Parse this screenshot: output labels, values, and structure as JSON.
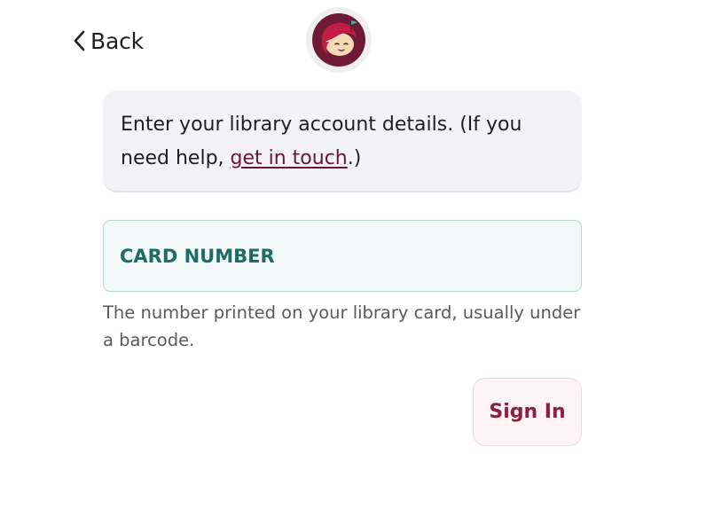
{
  "nav": {
    "back_label": "Back"
  },
  "info": {
    "text_before": "Enter your library account details. (If you need help, ",
    "link": "get in touch",
    "text_after": ".)"
  },
  "card_field": {
    "placeholder": "CARD NUMBER",
    "value": "",
    "helper": "The number printed on your library card, usually under a barcode."
  },
  "actions": {
    "sign_in_label": "Sign In"
  },
  "colors": {
    "brand_maroon": "#8c1f3d",
    "link": "#6b1533",
    "field_teal": "#1e6b67",
    "field_bg": "#f2f8f7",
    "info_bg": "#f3f2f6"
  },
  "icons": {
    "back": "chevron-left-icon",
    "logo": "libby-logo"
  }
}
